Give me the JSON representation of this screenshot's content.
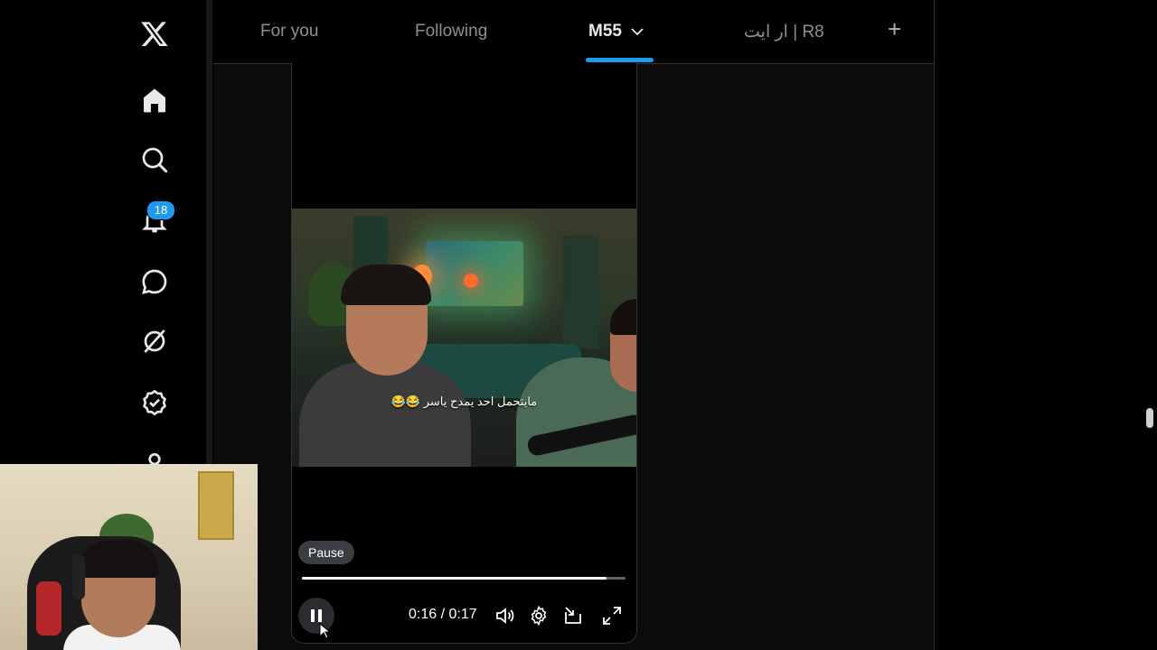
{
  "tabs": [
    {
      "label": "For you"
    },
    {
      "label": "Following"
    },
    {
      "label": "M55"
    },
    {
      "label": "ار ايت | R8"
    }
  ],
  "notifications": {
    "badge": "18"
  },
  "video": {
    "subtitle": "مايتحمل احد يمدح ياسر 😂😂",
    "tooltip": "Pause",
    "time": "0:16 / 0:17",
    "progress_fraction": 0.94
  },
  "colors": {
    "accent": "#1d9bf0",
    "background": "#000000"
  }
}
